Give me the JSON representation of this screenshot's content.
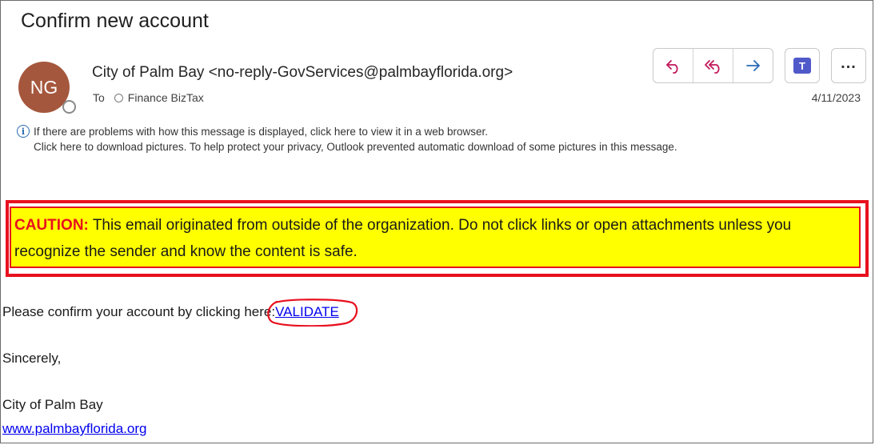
{
  "email": {
    "subject": "Confirm new account",
    "avatar_initials": "NG",
    "sender": "City of Palm Bay <no-reply-GovServices@palmbayflorida.org>",
    "to_label": "To",
    "recipient": "Finance BizTax",
    "date": "4/11/2023"
  },
  "actions": {
    "reply_icon": "reply-icon",
    "reply_all_icon": "reply-all-icon",
    "forward_icon": "forward-icon",
    "teams_icon": "teams-icon",
    "teams_glyph": "T",
    "more_icon": "more-icon",
    "more_glyph": "..."
  },
  "info_bar": {
    "line1": "If there are problems with how this message is displayed, click here to view it in a web browser.",
    "line2": "Click here to download pictures. To help protect your privacy, Outlook prevented automatic download of some pictures in this message."
  },
  "caution": {
    "label": "CAUTION:",
    "text": " This email originated from outside of the organization. Do not click links or open attachments unless you recognize the sender and know the content is safe.",
    "border_color": "#e8101e",
    "background_color": "#ffff00"
  },
  "body": {
    "confirm_text": "Please confirm your account by clicking here:",
    "validate_link": "VALIDATE",
    "closing": "Sincerely,",
    "signature_name": "City of Palm Bay",
    "signature_url": "www.palmbayflorida.org"
  },
  "colors": {
    "link": "#0000ee",
    "avatar_bg": "#a5573d",
    "accent_blue": "#2a6bb3",
    "icon_pink": "#c2185b"
  }
}
